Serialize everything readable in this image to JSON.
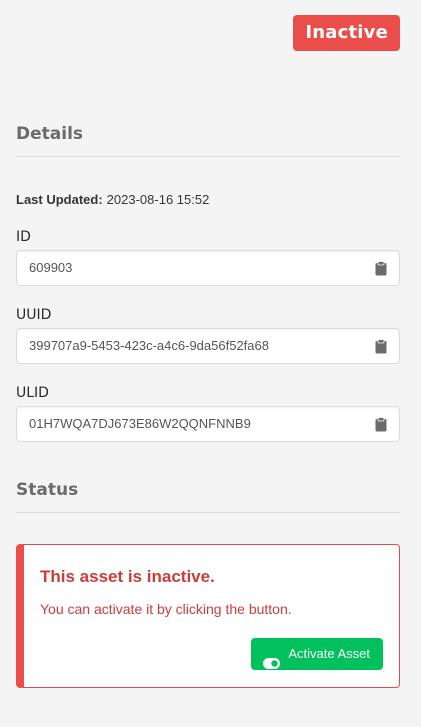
{
  "status_tag": "Inactive",
  "details": {
    "title": "Details",
    "last_updated_label": "Last Updated:",
    "last_updated_value": "2023-08-16 15:52",
    "fields": [
      {
        "label": "ID",
        "value": "609903"
      },
      {
        "label": "UUID",
        "value": "399707a9-5453-423c-a4c6-9da56f52fa68"
      },
      {
        "label": "ULID",
        "value": "01H7WQA7DJ673E86W2QQNFNNB9"
      }
    ]
  },
  "status": {
    "title": "Status",
    "alert_title": "This asset is inactive.",
    "alert_text": "You can activate it by clicking the button.",
    "activate_label": "Activate Asset"
  },
  "icons": {
    "copy": "clipboard-icon",
    "toggle": "toggle-on-icon"
  },
  "colors": {
    "danger": "#ea4e4b",
    "success": "#00c15b",
    "background": "#f4f4f4"
  }
}
